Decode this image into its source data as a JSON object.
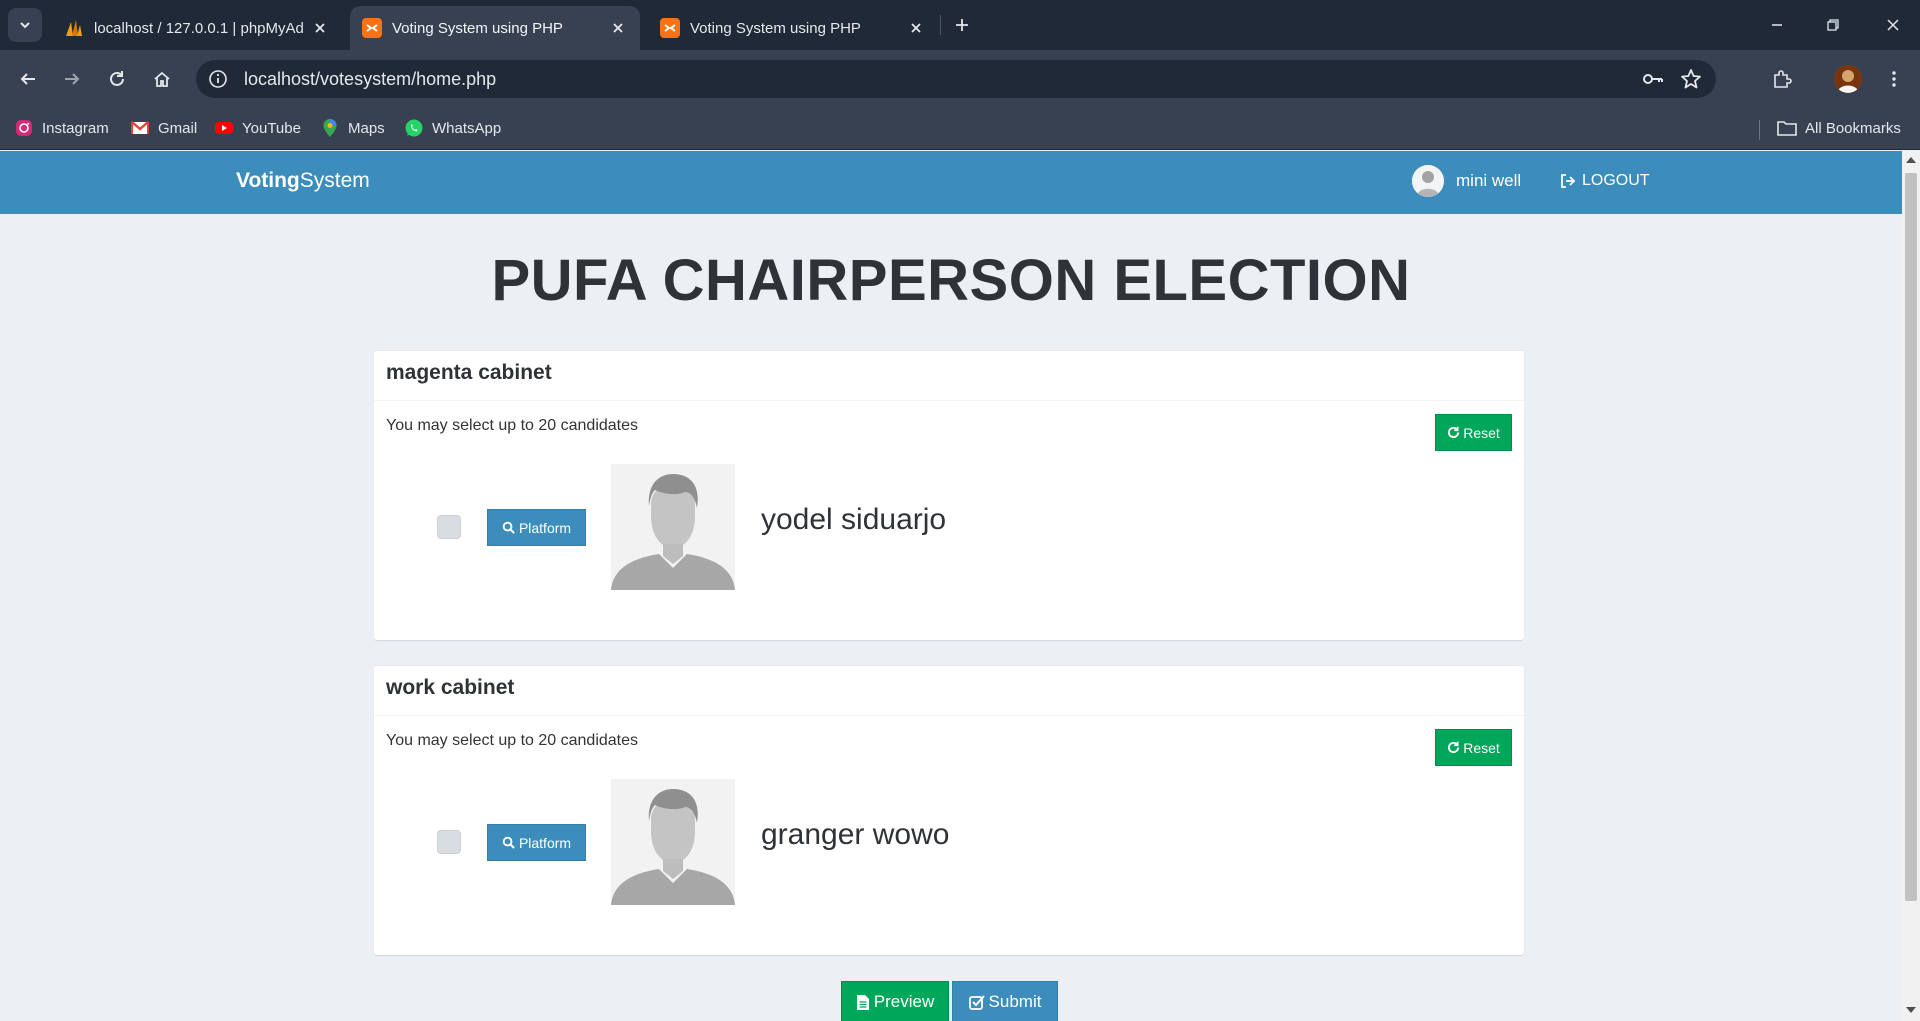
{
  "browser": {
    "tabs": [
      {
        "title": "localhost / 127.0.0.1 | phpMyAd",
        "icon": "phpmyadmin-icon",
        "active": false
      },
      {
        "title": "Voting System using PHP",
        "icon": "xampp-icon",
        "active": true
      },
      {
        "title": "Voting System using PHP",
        "icon": "xampp-icon",
        "active": false
      }
    ],
    "url": "localhost/votesystem/home.php",
    "bookmarks": [
      {
        "label": "Instagram",
        "icon": "instagram-icon"
      },
      {
        "label": "Gmail",
        "icon": "gmail-icon"
      },
      {
        "label": "YouTube",
        "icon": "youtube-icon"
      },
      {
        "label": "Maps",
        "icon": "maps-icon"
      },
      {
        "label": "WhatsApp",
        "icon": "whatsapp-icon"
      }
    ],
    "all_bookmarks": "All Bookmarks"
  },
  "app": {
    "brand_bold": "Voting",
    "brand_rest": "System",
    "user_name": "mini well",
    "logout_label": "LOGOUT",
    "accent_color": "#3c8dbc",
    "success_color": "#00a65a"
  },
  "election": {
    "title": "PUFA CHAIRPERSON ELECTION",
    "positions": [
      {
        "name": "magenta cabinet",
        "instruction": "You may select up to 20 candidates",
        "reset_label": "Reset",
        "candidate": {
          "platform_label": "Platform",
          "name": "yodel siduarjo"
        }
      },
      {
        "name": "work cabinet",
        "instruction": "You may select up to 20 candidates",
        "reset_label": "Reset",
        "candidate": {
          "platform_label": "Platform",
          "name": "granger wowo"
        }
      }
    ],
    "preview_label": "Preview",
    "submit_label": "Submit"
  }
}
